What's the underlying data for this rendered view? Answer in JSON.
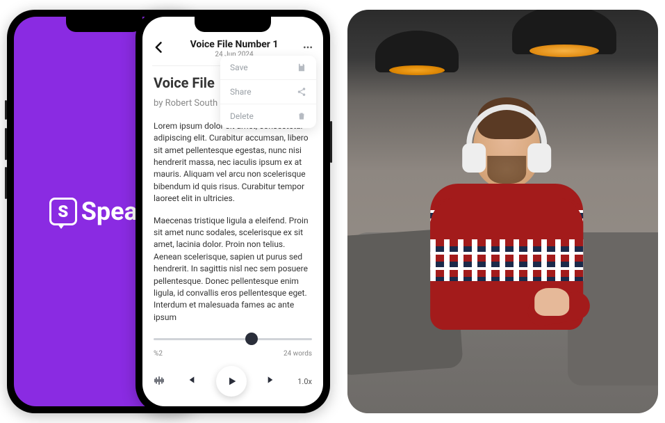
{
  "brand": {
    "name": "Speakt",
    "icon_letter": "S"
  },
  "header": {
    "title": "Voice File Number 1",
    "date": "24 Jun 2024"
  },
  "document": {
    "title_visible": "Voice  File ",
    "author_visible": "by Robert South",
    "para1": "Lorem ipsum dolor sit amet, consectetur adipiscing elit. Curabitur accumsan, libero sit amet pellentesque egestas, nunc nisi hendrerit massa, nec iaculis ipsum ex at mauris. Aliquam vel arcu non scelerisque bibendum id quis risus. Curabitur tempor laoreet elit in ultricies.",
    "para2": "Maecenas tristique ligula a eleifend. Proin sit amet nunc sodales, scelerisque ex sit amet, lacinia dolor. Proin non telius. Aenean scelerisque, sapien ut purus sed hendrerit. In sagittis nisl nec sem posuere pellentesque. Donec pellentesque enim ligula, id convallis eros pellentesque eget. Interdum et malesuada fames ac ante ipsum"
  },
  "menu": {
    "save": "Save",
    "share": "Share",
    "delete": "Delete"
  },
  "player": {
    "percent_label": "%2",
    "words_label": "24 words",
    "speed": "1.0x",
    "progress_pct": 62
  },
  "colors": {
    "brand_purple": "#8a2be2",
    "text_muted": "#888888",
    "control_dark": "#2a2e3a",
    "sweater_red": "#a31b1b"
  }
}
